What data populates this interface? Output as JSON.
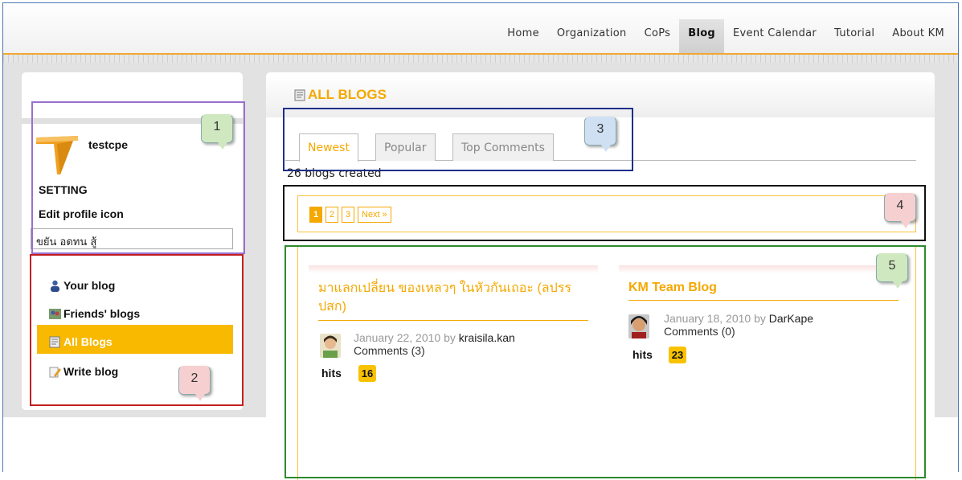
{
  "nav": {
    "items": [
      "Home",
      "Organization",
      "CoPs",
      "Blog",
      "Event Calendar",
      "Tutorial",
      "About KM"
    ],
    "active": "Blog"
  },
  "profile": {
    "username": "testcpe",
    "setting_label": "SETTING",
    "edit_profile_label": "Edit profile icon",
    "status_text": "ขยัน อดทน สู้"
  },
  "blog_menu": [
    {
      "label": "Your blog",
      "icon": "user-icon"
    },
    {
      "label": "Friends' blogs",
      "icon": "friends-icon"
    },
    {
      "label": "All Blogs",
      "icon": "blog-page-icon",
      "active": true
    },
    {
      "label": "Write blog",
      "icon": "pencil-icon"
    }
  ],
  "main": {
    "title": "ALL BLOGS",
    "tabs": [
      "Newest",
      "Popular",
      "Top Comments"
    ],
    "active_tab": "Newest",
    "count_text": "26 blogs created",
    "pagination": {
      "pages": [
        "1",
        "2",
        "3"
      ],
      "current": "1",
      "next_label": "Next »"
    }
  },
  "posts": [
    {
      "title": "มาแลกเปลี่ยน ของเหลวๆ ในหัวกันเถอะ (ลปรร ปสก)",
      "date_by": "January 22, 2010 by ",
      "author": "kraisila.kan",
      "comments": "Comments (3)",
      "hits_label": "hits",
      "hits": "16"
    },
    {
      "title": "KM Team Blog",
      "date_by": "January 18, 2010 by ",
      "author": "DarKape",
      "comments": "Comments (0)",
      "hits_label": "hits",
      "hits": "23"
    }
  ],
  "annotations": [
    {
      "label": "1",
      "color": "#9a6fd0",
      "bubble": "#cfe8bf"
    },
    {
      "label": "2",
      "color": "#c41e1e",
      "bubble": "#f6d0d0"
    },
    {
      "label": "3",
      "color": "#1f2f8a",
      "bubble": "#cfe0f2"
    },
    {
      "label": "4",
      "color": "#111111",
      "bubble": "#f6d0d0"
    },
    {
      "label": "5",
      "color": "#2e8a2e",
      "bubble": "#cfe8bf"
    }
  ],
  "colors": {
    "accent": "#f5a800",
    "highlight": "#f9b900",
    "frame": "#4a78b8"
  }
}
